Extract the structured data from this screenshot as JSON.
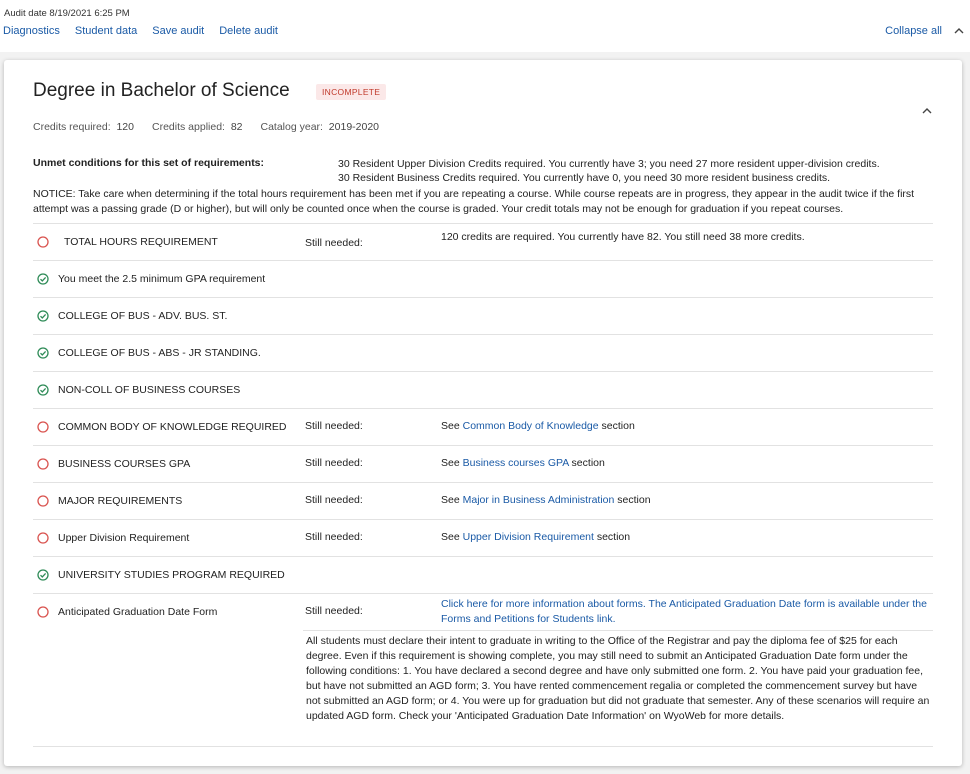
{
  "header": {
    "audit_date": "Audit date 8/19/2021 6:25 PM",
    "links": [
      "Diagnostics",
      "Student data",
      "Save audit",
      "Delete audit"
    ],
    "collapse_all": "Collapse all"
  },
  "degree": {
    "title": "Degree in Bachelor of Science",
    "status": "INCOMPLETE",
    "credits_required_label": "Credits required:",
    "credits_required": "120",
    "credits_applied_label": "Credits applied:",
    "credits_applied": "82",
    "catalog_year_label": "Catalog year:",
    "catalog_year": "2019-2020"
  },
  "unmet": {
    "label": "Unmet conditions for this set of requirements:",
    "lines": [
      "30 Resident Upper Division Credits required. You currently have 3; you need 27 more resident upper-division credits.",
      "30 Resident Business Credits required. You currently have 0, you need 30 more resident business credits."
    ],
    "notice": "NOTICE: Take care when determining if the total hours requirement has been met if you are repeating a course. While course repeats are in progress, they appear in the audit twice if the first attempt was a passing grade (D or higher), but will only be counted once when the course is graded. Your credit totals may not be enough for graduation if you repeat courses."
  },
  "still_needed_label": "Still needed:",
  "requirements": [
    {
      "label": "TOTAL HOURS REQUIREMENT",
      "status": "incomplete",
      "detail": "120 credits are required. You currently have 82. You still need 38 more credits."
    },
    {
      "label": "You meet the 2.5 minimum GPA requirement",
      "status": "complete"
    },
    {
      "label": "COLLEGE OF BUS - ADV. BUS. ST.",
      "status": "complete"
    },
    {
      "label": "COLLEGE OF BUS - ABS - JR STANDING.",
      "status": "complete"
    },
    {
      "label": "NON-COLL OF BUSINESS COURSES",
      "status": "complete"
    },
    {
      "label": "COMMON BODY OF KNOWLEDGE REQUIRED",
      "status": "incomplete",
      "see": "See",
      "link": "Common Body of Knowledge",
      "suffix": "section"
    },
    {
      "label": "BUSINESS COURSES GPA",
      "status": "incomplete",
      "see": "See",
      "link": "Business courses GPA",
      "suffix": "section"
    },
    {
      "label": "MAJOR REQUIREMENTS",
      "status": "incomplete",
      "see": "See",
      "link": "Major in Business Administration",
      "suffix": "section"
    },
    {
      "label": "Upper Division Requirement",
      "status": "incomplete",
      "see": "See",
      "link": "Upper Division Requirement",
      "suffix": "section"
    },
    {
      "label": "UNIVERSITY STUDIES PROGRAM REQUIRED",
      "status": "complete"
    },
    {
      "label": "Anticipated Graduation Date Form",
      "status": "incomplete",
      "link": "Click here for more information about forms. The Anticipated Graduation Date form is available under the Forms and Petitions for Students link.",
      "detail": "All students must declare their intent to graduate in writing to the Office of the Registrar and pay the diploma fee of $25 for each degree. Even if this requirement is showing complete, you may still need to submit an Anticipated Graduation Date form under the following conditions: 1. You have declared a second degree and have only submitted one form. 2. You have paid your graduation fee, but have not submitted an AGD form; 3. You have rented commencement regalia or completed the commencement survey but have not submitted an AGD form; or 4. You were up for graduation but did not graduate that semester. Any of these scenarios will require an updated AGD form. Check your 'Anticipated Graduation Date Information' on WyoWeb for more details."
    }
  ],
  "colors": {
    "link": "#1a5aa6",
    "incomplete": "#d9534f",
    "complete": "#2e8b57"
  }
}
